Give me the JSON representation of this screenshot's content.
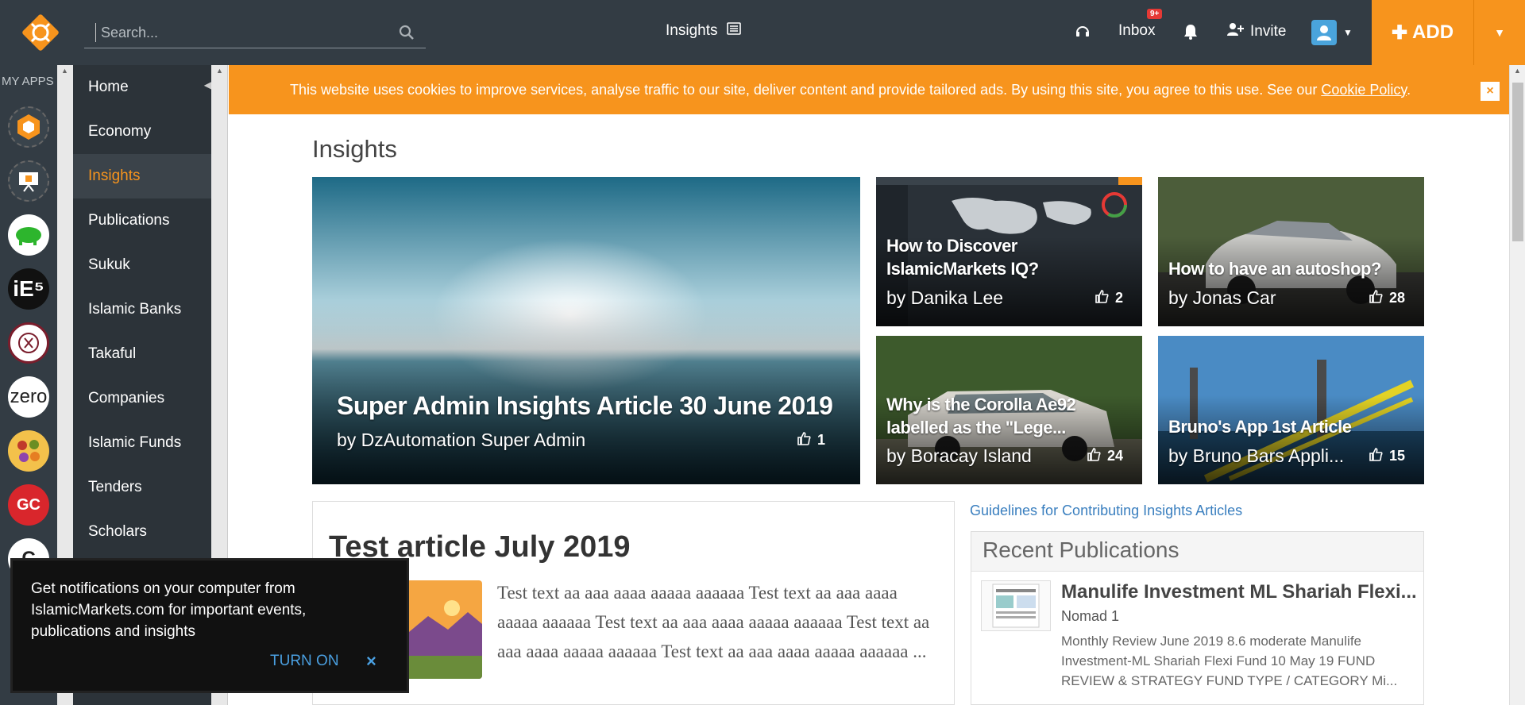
{
  "header": {
    "search_placeholder": "Search...",
    "center_label": "Insights",
    "inbox_label": "Inbox",
    "inbox_badge": "9+",
    "invite_label": "Invite",
    "add_label": "ADD"
  },
  "apps": {
    "label": "MY APPS"
  },
  "nav": {
    "items": [
      "Home",
      "Economy",
      "Insights",
      "Publications",
      "Sukuk",
      "Islamic Banks",
      "Takaful",
      "Companies",
      "Islamic Funds",
      "Tenders",
      "Scholars"
    ],
    "active": "Insights"
  },
  "cookie": {
    "text": "This website uses cookies to improve services, analyse traffic to our site, deliver content and provide tailored ads. By using this site, you agree to this use. See our ",
    "link": "Cookie Policy",
    "suffix": "."
  },
  "page_title": "Insights",
  "featured": [
    {
      "title": "Super Admin Insights Article 30 June 2019",
      "author": "by DzAutomation Super Admin",
      "likes": "1"
    },
    {
      "title": "How to Discover IslamicMarkets IQ?",
      "author": "by Danika Lee",
      "likes": "2"
    },
    {
      "title": "How to have an autoshop?",
      "author": "by Jonas Car",
      "likes": "28"
    },
    {
      "title": "Why is the Corolla Ae92 labelled as the \"Lege...",
      "author": "by Boracay Island",
      "likes": "24"
    },
    {
      "title": "Bruno's App 1st Article",
      "author": "by Bruno Bars Appli...",
      "likes": "15"
    }
  ],
  "article": {
    "title": "Test article July 2019",
    "body": "Test text aa aaa aaaa aaaaa aaaaaa Test text aa aaa aaaa aaaaa aaaaaa Test text aa aaa aaaa aaaaa aaaaaa Test text aa aaa aaaa aaaaa aaaaaa Test text aa aaa aaaa aaaaa aaaaaa ..."
  },
  "sidebar": {
    "guidelines": "Guidelines for Contributing Insights Articles",
    "recent_title": "Recent Publications",
    "pub_title": "Manulife Investment ML Shariah Flexi...",
    "pub_author": "Nomad 1",
    "pub_desc": "Monthly Review June 2019 8.6 moderate Manulife Investment-ML Shariah Flexi Fund 10 May 19 FUND REVIEW & STRATEGY FUND TYPE / CATEGORY Mi..."
  },
  "notification": {
    "text": "Get notifications on your computer from IslamicMarkets.com for important events, publications and insights",
    "turn_on": "TURN ON",
    "close": "×"
  },
  "colors": {
    "accent": "#f7941d",
    "topbar": "#333c44",
    "nav": "#2c3339",
    "link": "#3a7fbf"
  }
}
